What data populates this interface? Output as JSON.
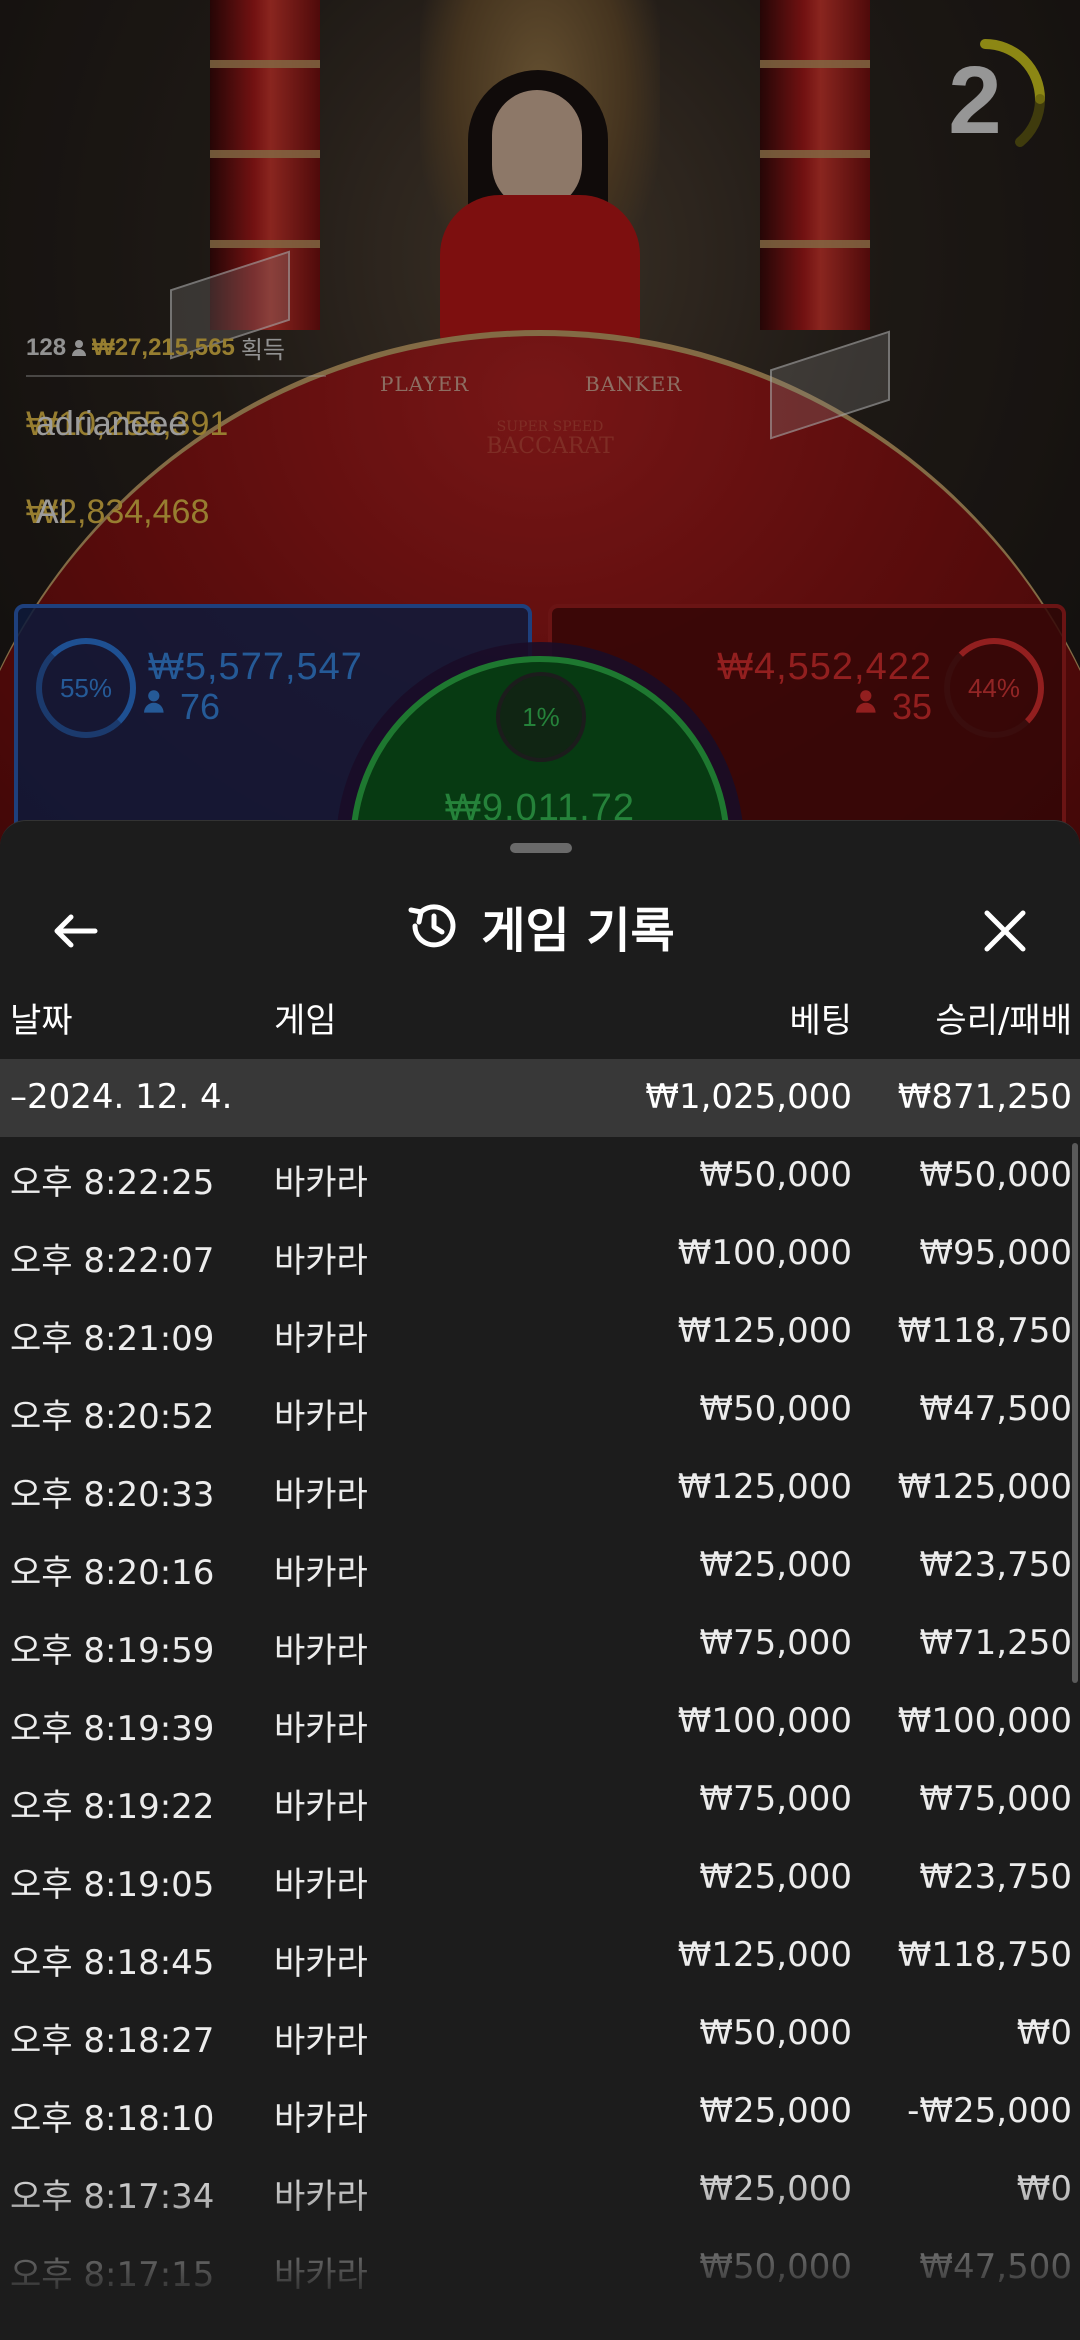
{
  "game": {
    "countdown": "2",
    "table_labels": {
      "player": "PLAYER",
      "banker": "BANKER",
      "logo_line1": "SUPER SPEED",
      "logo_line2": "BACCARAT"
    },
    "winners": {
      "count": "128",
      "total": "₩27,215,565",
      "won_label": "획득",
      "rows": [
        {
          "amount": "₩10,255,391",
          "user": "adrianeee"
        },
        {
          "amount": "₩2,834,468",
          "user": "AI"
        }
      ]
    },
    "player_bet": {
      "percent": "55%",
      "amount": "₩5,577,547",
      "players": "76"
    },
    "banker_bet": {
      "percent": "44%",
      "amount": "₩4,552,422",
      "players": "35"
    },
    "tie_bet": {
      "percent": "1%",
      "amount": "₩9,011,72"
    }
  },
  "sheet": {
    "title": "게임 기록",
    "columns": {
      "date": "날짜",
      "game": "게임",
      "bet": "베팅",
      "result": "승리/패배"
    },
    "summary": {
      "date": "–2024. 12. 4.",
      "bet": "₩1,025,000",
      "result": "₩871,250"
    },
    "rows": [
      {
        "time": "오후 8:22:25",
        "game": "바카라",
        "bet": "₩50,000",
        "result": "₩50,000"
      },
      {
        "time": "오후 8:22:07",
        "game": "바카라",
        "bet": "₩100,000",
        "result": "₩95,000"
      },
      {
        "time": "오후 8:21:09",
        "game": "바카라",
        "bet": "₩125,000",
        "result": "₩118,750"
      },
      {
        "time": "오후 8:20:52",
        "game": "바카라",
        "bet": "₩50,000",
        "result": "₩47,500"
      },
      {
        "time": "오후 8:20:33",
        "game": "바카라",
        "bet": "₩125,000",
        "result": "₩125,000"
      },
      {
        "time": "오후 8:20:16",
        "game": "바카라",
        "bet": "₩25,000",
        "result": "₩23,750"
      },
      {
        "time": "오후 8:19:59",
        "game": "바카라",
        "bet": "₩75,000",
        "result": "₩71,250"
      },
      {
        "time": "오후 8:19:39",
        "game": "바카라",
        "bet": "₩100,000",
        "result": "₩100,000"
      },
      {
        "time": "오후 8:19:22",
        "game": "바카라",
        "bet": "₩75,000",
        "result": "₩75,000"
      },
      {
        "time": "오후 8:19:05",
        "game": "바카라",
        "bet": "₩25,000",
        "result": "₩23,750"
      },
      {
        "time": "오후 8:18:45",
        "game": "바카라",
        "bet": "₩125,000",
        "result": "₩118,750"
      },
      {
        "time": "오후 8:18:27",
        "game": "바카라",
        "bet": "₩50,000",
        "result": "₩0"
      },
      {
        "time": "오후 8:18:10",
        "game": "바카라",
        "bet": "₩25,000",
        "result": "-₩25,000"
      },
      {
        "time": "오후 8:17:34",
        "game": "바카라",
        "bet": "₩25,000",
        "result": "₩0"
      },
      {
        "time": "오후 8:17:15",
        "game": "바카라",
        "bet": "₩50,000",
        "result": "₩47,500"
      }
    ]
  },
  "colors": {
    "accent_gold": "#e8c24a",
    "player_blue": "#3a8ae8",
    "banker_red": "#e03030",
    "tie_green": "#3ac85a",
    "sheet_bg": "#1c1c1c"
  },
  "icons": {
    "back": "arrow-left-icon",
    "history": "history-icon",
    "close": "close-icon",
    "person": "person-icon"
  }
}
